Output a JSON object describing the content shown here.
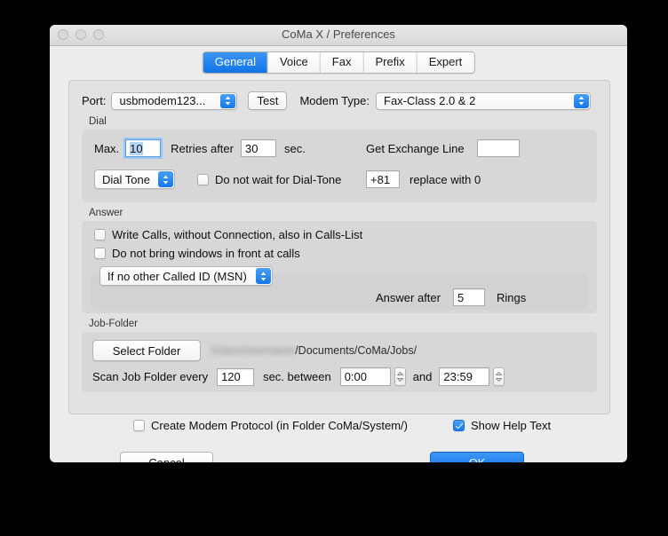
{
  "window": {
    "title": "CoMa X / Preferences",
    "traffic_lights": [
      "close",
      "minimize",
      "zoom"
    ]
  },
  "tabs": [
    {
      "label": "General",
      "active": true
    },
    {
      "label": "Voice",
      "active": false
    },
    {
      "label": "Fax",
      "active": false
    },
    {
      "label": "Prefix",
      "active": false
    },
    {
      "label": "Expert",
      "active": false
    }
  ],
  "port_row": {
    "port_label": "Port:",
    "port_value": "usbmodem123...",
    "test_label": "Test",
    "modem_type_label": "Modem Type:",
    "modem_type_value": "Fax-Class 2.0 & 2"
  },
  "dial": {
    "group_title": "Dial",
    "max_label": "Max.",
    "max_value": "10",
    "retries_label": "Retries after",
    "retries_value": "30",
    "sec_label": "sec.",
    "exchange_label": "Get Exchange Line",
    "exchange_value": "",
    "dial_tone_value": "Dial Tone",
    "no_wait_label": "Do not wait for Dial-Tone",
    "no_wait_checked": false,
    "country_code_value": "+81",
    "replace_label": "replace with 0"
  },
  "answer": {
    "group_title": "Answer",
    "write_calls_label": "Write Calls, without Connection, also in Calls-List",
    "write_calls_checked": false,
    "no_front_label": "Do not bring windows in front at calls",
    "no_front_checked": false,
    "msn_value": "If no other Called ID (MSN)",
    "answer_after_label": "Answer after",
    "rings_value": "5",
    "rings_label": "Rings"
  },
  "job_folder": {
    "group_title": "Job-Folder",
    "select_folder_label": "Select Folder",
    "path_redacted": "/Users/username",
    "path_visible": "/Documents/CoMa/Jobs/",
    "scan_label": "Scan Job Folder every",
    "scan_value": "120",
    "sec_between_label": "sec. between",
    "time_from": "0:00",
    "and_label": "and",
    "time_to": "23:59"
  },
  "footer": {
    "modem_protocol_label": "Create Modem Protocol (in Folder CoMa/System/)",
    "modem_protocol_checked": false,
    "show_help_label": "Show Help Text",
    "show_help_checked": true,
    "cancel_label": "Cancel",
    "ok_label": "OK"
  },
  "colors": {
    "accent_blue": "#1273e8",
    "window_bg": "#ececec",
    "panel_bg": "#e2e2e2",
    "group_bg": "#d7d7d7"
  }
}
